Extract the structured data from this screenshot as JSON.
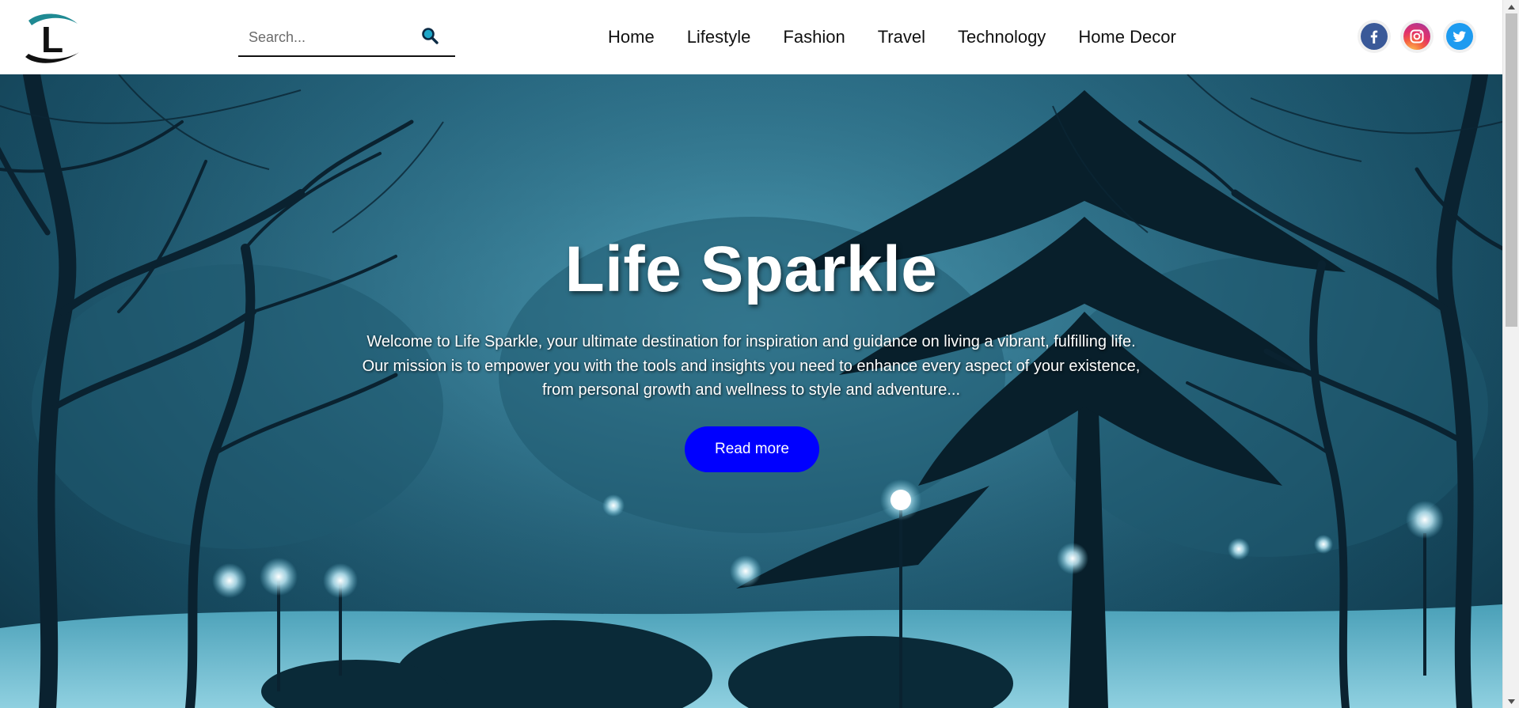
{
  "header": {
    "logo_letter": "L",
    "search": {
      "placeholder": "Search...",
      "value": ""
    },
    "nav": [
      {
        "label": "Home"
      },
      {
        "label": "Lifestyle"
      },
      {
        "label": "Fashion"
      },
      {
        "label": "Travel"
      },
      {
        "label": "Technology"
      },
      {
        "label": "Home Decor"
      }
    ],
    "socials": [
      {
        "icon": "facebook-icon",
        "color": "#3a5998"
      },
      {
        "icon": "instagram-icon",
        "color": "#e1306c"
      },
      {
        "icon": "twitter-icon",
        "color": "#1d9bf0"
      }
    ]
  },
  "hero": {
    "title": "Life Sparkle",
    "text_lines": [
      "Welcome to Life Sparkle, your ultimate destination for inspiration and guidance on living a vibrant, fulfilling life.",
      "Our mission is to empower you with the tools and insights you need to enhance every aspect of your existence,",
      "from personal growth and wellness to style and adventure..."
    ],
    "button_label": "Read more",
    "button_color": "#0000ff",
    "background_theme": "snowy park at night with trees and lamps"
  },
  "colors": {
    "accent": "#0000ff",
    "header_bg": "#ffffff",
    "hero_tint": "#2b6f89"
  }
}
